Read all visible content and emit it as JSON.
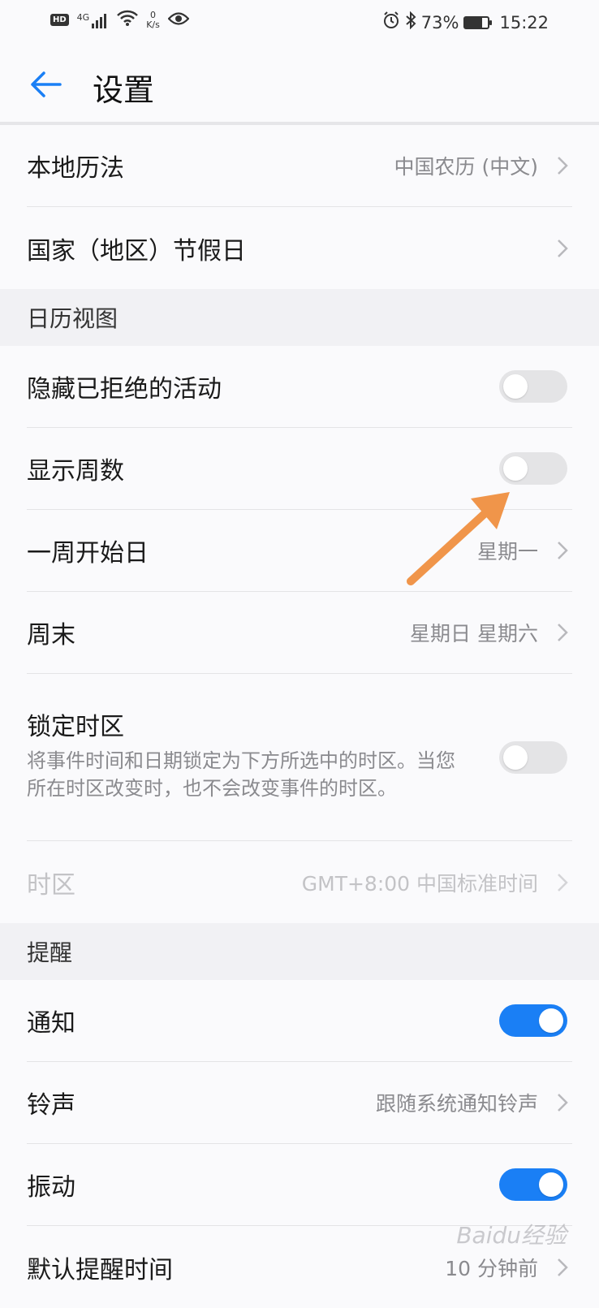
{
  "status": {
    "left": {
      "hd": "HD",
      "net": "4G",
      "speed_value": "0",
      "speed_unit": "K/s"
    },
    "right": {
      "battery": "73%",
      "time": "15:22"
    },
    "battery_level": 0.73
  },
  "header": {
    "title": "设置"
  },
  "rows_top": [
    {
      "label": "本地历法",
      "value": "中国农历 (中文)"
    },
    {
      "label": "国家（地区）节假日",
      "value": ""
    }
  ],
  "section_view": "日历视图",
  "view": {
    "hide_declined": {
      "label": "隐藏已拒绝的活动"
    },
    "show_week": {
      "label": "显示周数"
    },
    "week_start": {
      "label": "一周开始日",
      "value": "星期一"
    },
    "weekend": {
      "label": "周末",
      "value": "星期日 星期六"
    },
    "lock_tz": {
      "label": "锁定时区",
      "desc": "将事件时间和日期锁定为下方所选中的时区。当您所在时区改变时，也不会改变事件的时区。"
    },
    "timezone": {
      "label": "时区",
      "value": "GMT+8:00 中国标准时间"
    }
  },
  "section_remind": "提醒",
  "remind": {
    "notify": {
      "label": "通知"
    },
    "ringtone": {
      "label": "铃声",
      "value": "跟随系统通知铃声"
    },
    "vibrate": {
      "label": "振动"
    },
    "default_time": {
      "label": "默认提醒时间",
      "value": "10 分钟前"
    }
  },
  "watermark": "Baidu经验",
  "colors": {
    "accent": "#1a7ff5",
    "annotation_arrow": "#f0954a"
  }
}
